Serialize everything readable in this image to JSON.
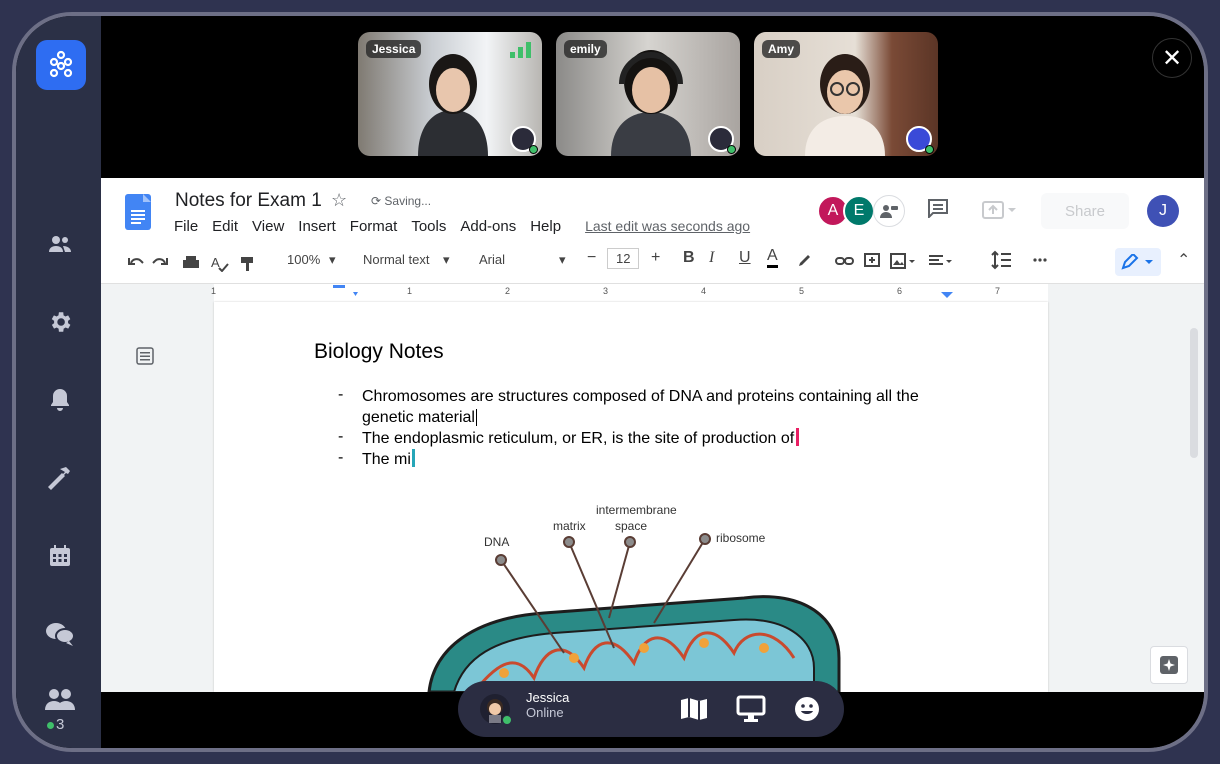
{
  "participants": [
    {
      "name": "Jessica"
    },
    {
      "name": "emily"
    },
    {
      "name": "Amy"
    }
  ],
  "sidebar": {
    "online_count": "3"
  },
  "doc": {
    "title": "Notes for Exam 1",
    "saving": "Saving...",
    "menu": [
      "File",
      "Edit",
      "View",
      "Insert",
      "Format",
      "Tools",
      "Add-ons",
      "Help"
    ],
    "last_edit": "Last edit was seconds ago",
    "collaborators": [
      "A",
      "E"
    ],
    "share": "Share",
    "user_initial": "J",
    "toolbar": {
      "zoom": "100%",
      "style": "Normal text",
      "font": "Arial",
      "size": "12"
    },
    "ruler_numbers": [
      "1",
      "1",
      "2",
      "3",
      "4",
      "5",
      "6",
      "7"
    ],
    "heading": "Biology Notes",
    "bullets": [
      {
        "line1": "Chromosomes are structures composed of DNA and proteins containing all the",
        "line2": "genetic material"
      },
      {
        "line1": "The endoplasmic reticulum, or ER, is the site of production of"
      },
      {
        "line1": "The mi"
      }
    ],
    "diagram_labels": {
      "dna": "DNA",
      "matrix": "matrix",
      "intermembrane": "intermembrane",
      "space": "space",
      "ribosome": "ribosome"
    }
  },
  "bottom": {
    "name": "Jessica",
    "status": "Online"
  },
  "colors": {
    "accent": "#2e6df2",
    "online": "#3fbf6a",
    "cursor_pink": "#e91e63",
    "cursor_teal": "#26a6b8"
  }
}
